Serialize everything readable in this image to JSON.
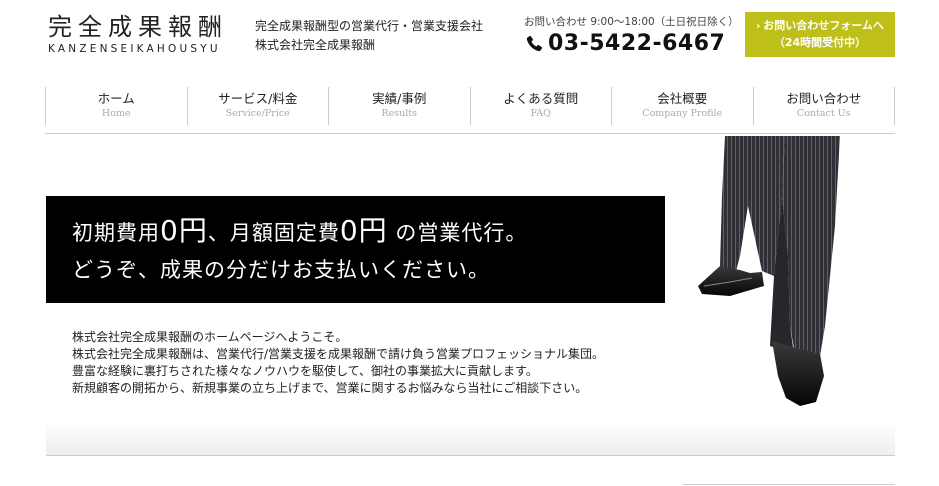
{
  "logo": {
    "title": "完全成果報酬",
    "subtitle": "KANZENSEIKAHOUSYU"
  },
  "tagline": {
    "line1": "完全成果報酬型の営業代行・営業支援会社",
    "line2": "株式会社完全成果報酬"
  },
  "contact": {
    "hours": "お問い合わせ 9:00～18:00（土日祝日除く）",
    "phone": "03-5422-6467",
    "phone_icon": "phone-icon"
  },
  "cta": {
    "line1": "お問い合わせフォームへ",
    "line2": "（24時間受付中）",
    "color": "#bfbf1a"
  },
  "nav": [
    {
      "jp": "ホーム",
      "en": "Home"
    },
    {
      "jp": "サービス/料金",
      "en": "Service/Price"
    },
    {
      "jp": "実績/事例",
      "en": "Results"
    },
    {
      "jp": "よくある質問",
      "en": "FAQ"
    },
    {
      "jp": "会社概要",
      "en": "Company Profile"
    },
    {
      "jp": "お問い合わせ",
      "en": "Contact Us"
    }
  ],
  "hero": {
    "l1a": "初期費用",
    "l1b": "0円",
    "l1c": "、月額固定費",
    "l1d": "0円",
    "l1e": " の営業代行。",
    "l2": "どうぞ、成果の分だけお支払いください。"
  },
  "intro": [
    "株式会社完全成果報酬のホームページへようこそ。",
    "株式会社完全成果報酬は、営業代行/営業支援を成果報酬で請け負う営業プロフェッショナル集団。",
    "豊富な経験に裏打ちされた様々なノウハウを駆使して、御社の事業拡大に貢献します。",
    "新規顧客の開拓から、新規事業の立ち上げまで、営業に関するお悩みなら当社にご相談下さい。"
  ]
}
